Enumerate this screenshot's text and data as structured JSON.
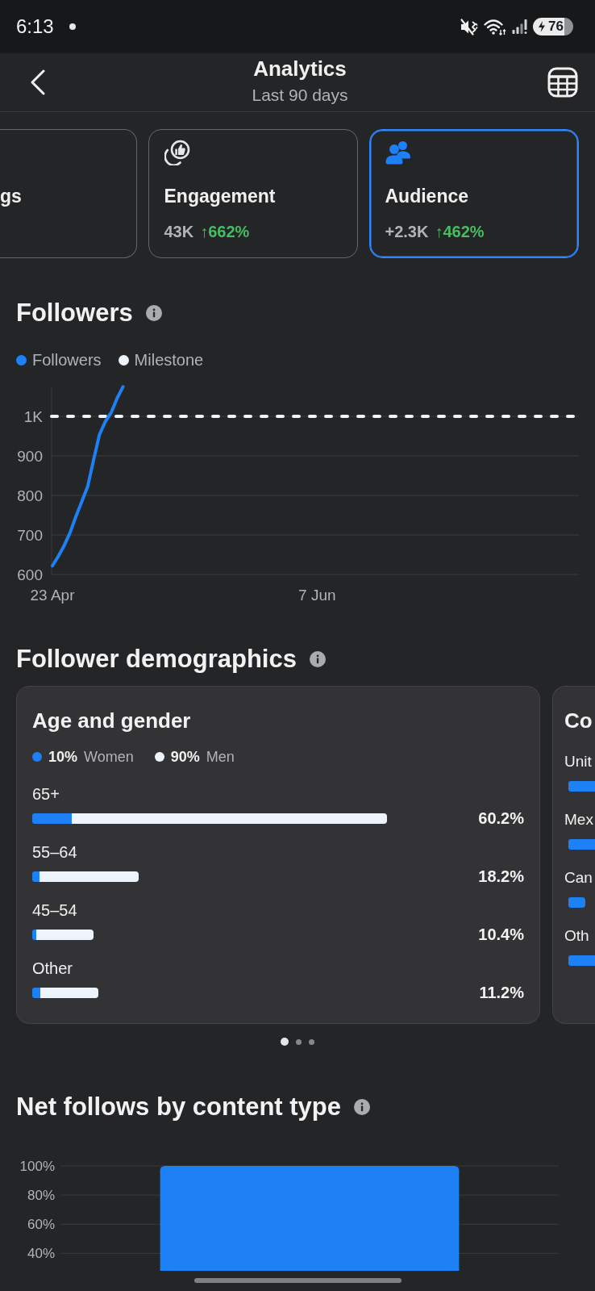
{
  "status_bar": {
    "time": "6:13",
    "battery": "76"
  },
  "header": {
    "title": "Analytics",
    "subtitle": "Last 90 days"
  },
  "metric_cards": [
    {
      "title": "gs",
      "selected": false
    },
    {
      "title": "Engagement",
      "value": "43K",
      "change": "↑662%",
      "selected": false
    },
    {
      "title": "Audience",
      "value": "+2.3K",
      "change": "↑462%",
      "selected": true
    }
  ],
  "followers": {
    "title": "Followers",
    "chart_data": {
      "type": "line",
      "grid": true,
      "categories": [
        "23 Apr",
        null,
        null,
        null,
        null,
        null,
        null,
        null,
        null,
        null,
        null,
        null,
        null,
        null,
        null,
        null,
        null,
        null,
        null,
        null,
        null,
        null,
        null,
        null,
        null,
        null,
        null,
        null,
        null,
        null,
        null,
        null,
        null,
        null,
        null,
        null,
        null,
        null,
        null,
        null,
        null,
        null,
        null,
        null,
        null,
        "7 Jun",
        null,
        null,
        null,
        null,
        null,
        null,
        null,
        null,
        null,
        null,
        null,
        null,
        null,
        null,
        null,
        null,
        null,
        null,
        null,
        null,
        null,
        null,
        null,
        null,
        null,
        null,
        null,
        null,
        null,
        null,
        null,
        null,
        null,
        null,
        null,
        null,
        null,
        null,
        null,
        null,
        null,
        null,
        null,
        null
      ],
      "ylim": [
        600,
        1075
      ],
      "yticks": [
        600,
        700,
        800,
        900,
        {
          "value": 1000,
          "label": "1K"
        }
      ],
      "series": [
        {
          "name": "Followers",
          "color": "#1e80f5",
          "values": [
            622,
            646,
            673,
            706,
            747,
            785,
            823,
            890,
            954,
            987,
            1010,
            1046,
            1075,
            null,
            null,
            null,
            null,
            null,
            null,
            null,
            null,
            null,
            null,
            null,
            null,
            null,
            null,
            null,
            null,
            null,
            null,
            null,
            null,
            null,
            null,
            null,
            null,
            null,
            null,
            null,
            null,
            null,
            null,
            null,
            null,
            null,
            null,
            null,
            null,
            null,
            null,
            null,
            null,
            null,
            null,
            null,
            null,
            null,
            null,
            null,
            null,
            null,
            null,
            null,
            null,
            null,
            null,
            null,
            null,
            null,
            null,
            null,
            null,
            null,
            null,
            null,
            null,
            null,
            null,
            null,
            null,
            null,
            null,
            null,
            null,
            null,
            null,
            null,
            null,
            null
          ]
        }
      ],
      "ref_lines": [
        {
          "axis": "y",
          "value": 1000,
          "label": "Milestone",
          "color": "#eef4fc"
        }
      ]
    }
  },
  "demographics": {
    "title": "Follower demographics",
    "cards": [
      {
        "title": "Age and gender",
        "legend": [
          {
            "value": "10%",
            "label": "Women",
            "color": "#1e80f5"
          },
          {
            "value": "90%",
            "label": "Men",
            "color": "#eef4fc"
          }
        ],
        "rows": [
          {
            "label": "65+",
            "value": "60.2%"
          },
          {
            "label": "55–64",
            "value": "18.2%"
          },
          {
            "label": "45–54",
            "value": "10.4%"
          },
          {
            "label": "Other",
            "value": "11.2%"
          }
        ]
      },
      {
        "title": "Co",
        "rows": [
          {
            "label": "Unit"
          },
          {
            "label": "Mex"
          },
          {
            "label": "Can"
          },
          {
            "label": "Oth"
          }
        ]
      }
    ],
    "pager": [
      {
        "selected": true
      },
      {
        "selected": false
      },
      {
        "selected": false
      }
    ]
  },
  "net_follows": {
    "title": "Net follows by content type",
    "chart_data": {
      "type": "bar",
      "grid": true,
      "values": [
        100
      ],
      "ylim": [
        28,
        100
      ],
      "yticks": [
        {
          "value": 40,
          "label": "40%"
        },
        {
          "value": 60,
          "label": "60%"
        },
        {
          "value": 80,
          "label": "80%"
        },
        {
          "value": 100,
          "label": "100%"
        }
      ]
    }
  }
}
